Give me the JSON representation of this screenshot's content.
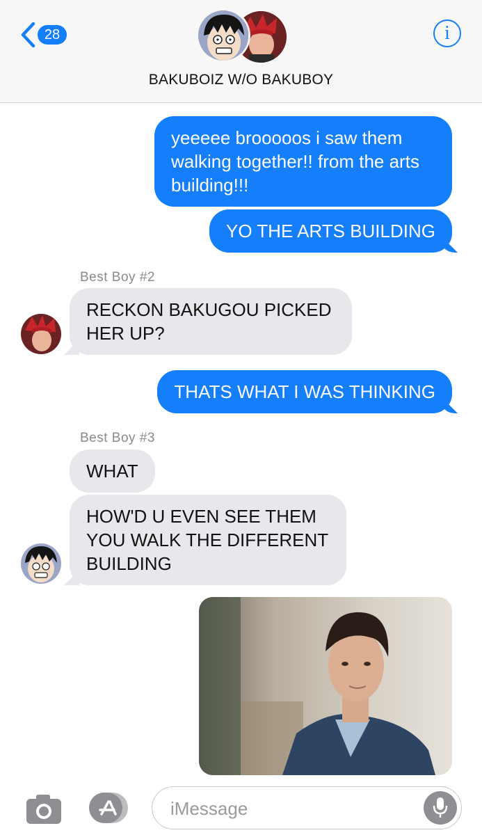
{
  "header": {
    "back_count": "28",
    "title": "BAKUBOIZ W/O BAKUBOY",
    "info_glyph": "i"
  },
  "messages": [
    {
      "direction": "out",
      "text": "yeeeee brooooos i saw them walking together!! from the arts building!!!"
    },
    {
      "direction": "out",
      "text": "YO THE ARTS BUILDING"
    },
    {
      "direction": "in",
      "sender": "Best Boy #2",
      "text": "RECKON BAKUGOU PICKED HER UP?"
    },
    {
      "direction": "out",
      "text": "THATS WHAT I WAS THINKING"
    },
    {
      "direction": "in",
      "sender": "Best Boy #3",
      "text": "WHAT"
    },
    {
      "direction": "in",
      "text": "HOW'D U EVEN SEE THEM YOU WALK THE DIFFERENT BUILDING"
    },
    {
      "direction": "out",
      "type": "photo"
    }
  ],
  "composer": {
    "placeholder": "iMessage"
  },
  "icons": [
    "back-chevron-icon",
    "info-icon",
    "camera-icon",
    "app-store-icon",
    "microphone-icon"
  ],
  "colors": {
    "accent": "#147efb",
    "incoming_bubble": "#e8e8ec"
  }
}
